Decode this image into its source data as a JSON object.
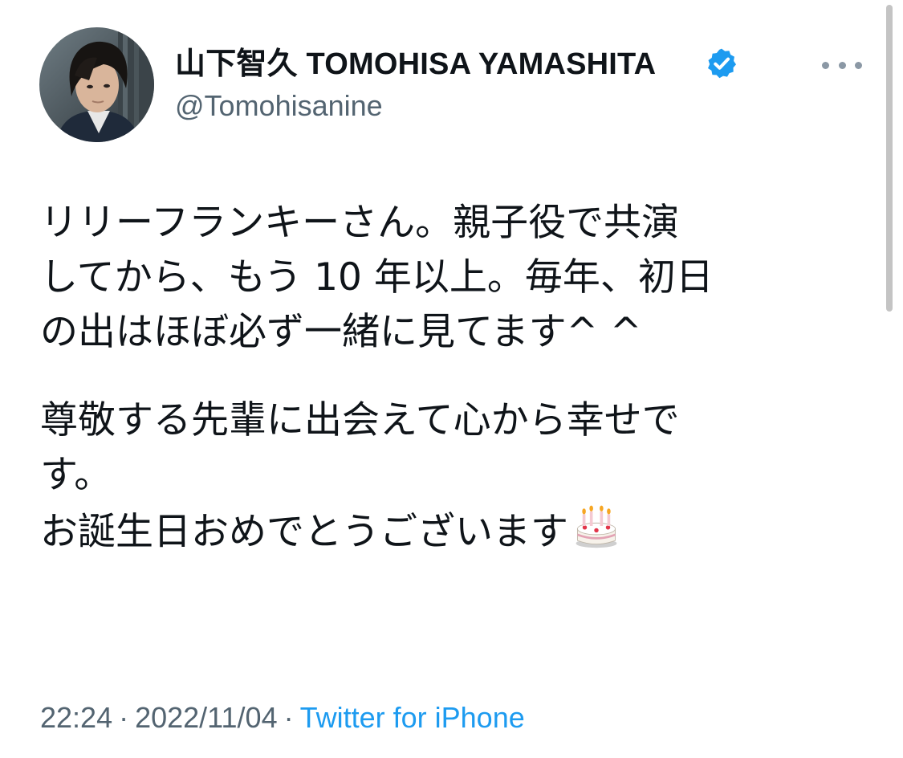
{
  "author": {
    "display_name": "山下智久 TOMOHISA YAMASHITA",
    "handle": "@Tomohisanine",
    "verified": true
  },
  "tweet": {
    "lines": [
      "リリーフランキーさん。親子役で共演",
      "してから、もう 10 年以上。毎年、初日",
      "の出はほぼ必ず一緒に見てます^ ^",
      "尊敬する先輩に出会えて心から幸せで",
      "す。",
      "お誕生日おめでとうございます"
    ],
    "emoji": "birthday-cake-icon"
  },
  "meta": {
    "time": "22:24",
    "separator": "·",
    "date": "2022/11/04",
    "source": "Twitter for iPhone"
  },
  "icons": {
    "verified": "verified-badge-icon",
    "more": "more-options-icon"
  },
  "colors": {
    "text": "#0f1419",
    "secondary": "#536471",
    "link": "#1d9bf0"
  }
}
